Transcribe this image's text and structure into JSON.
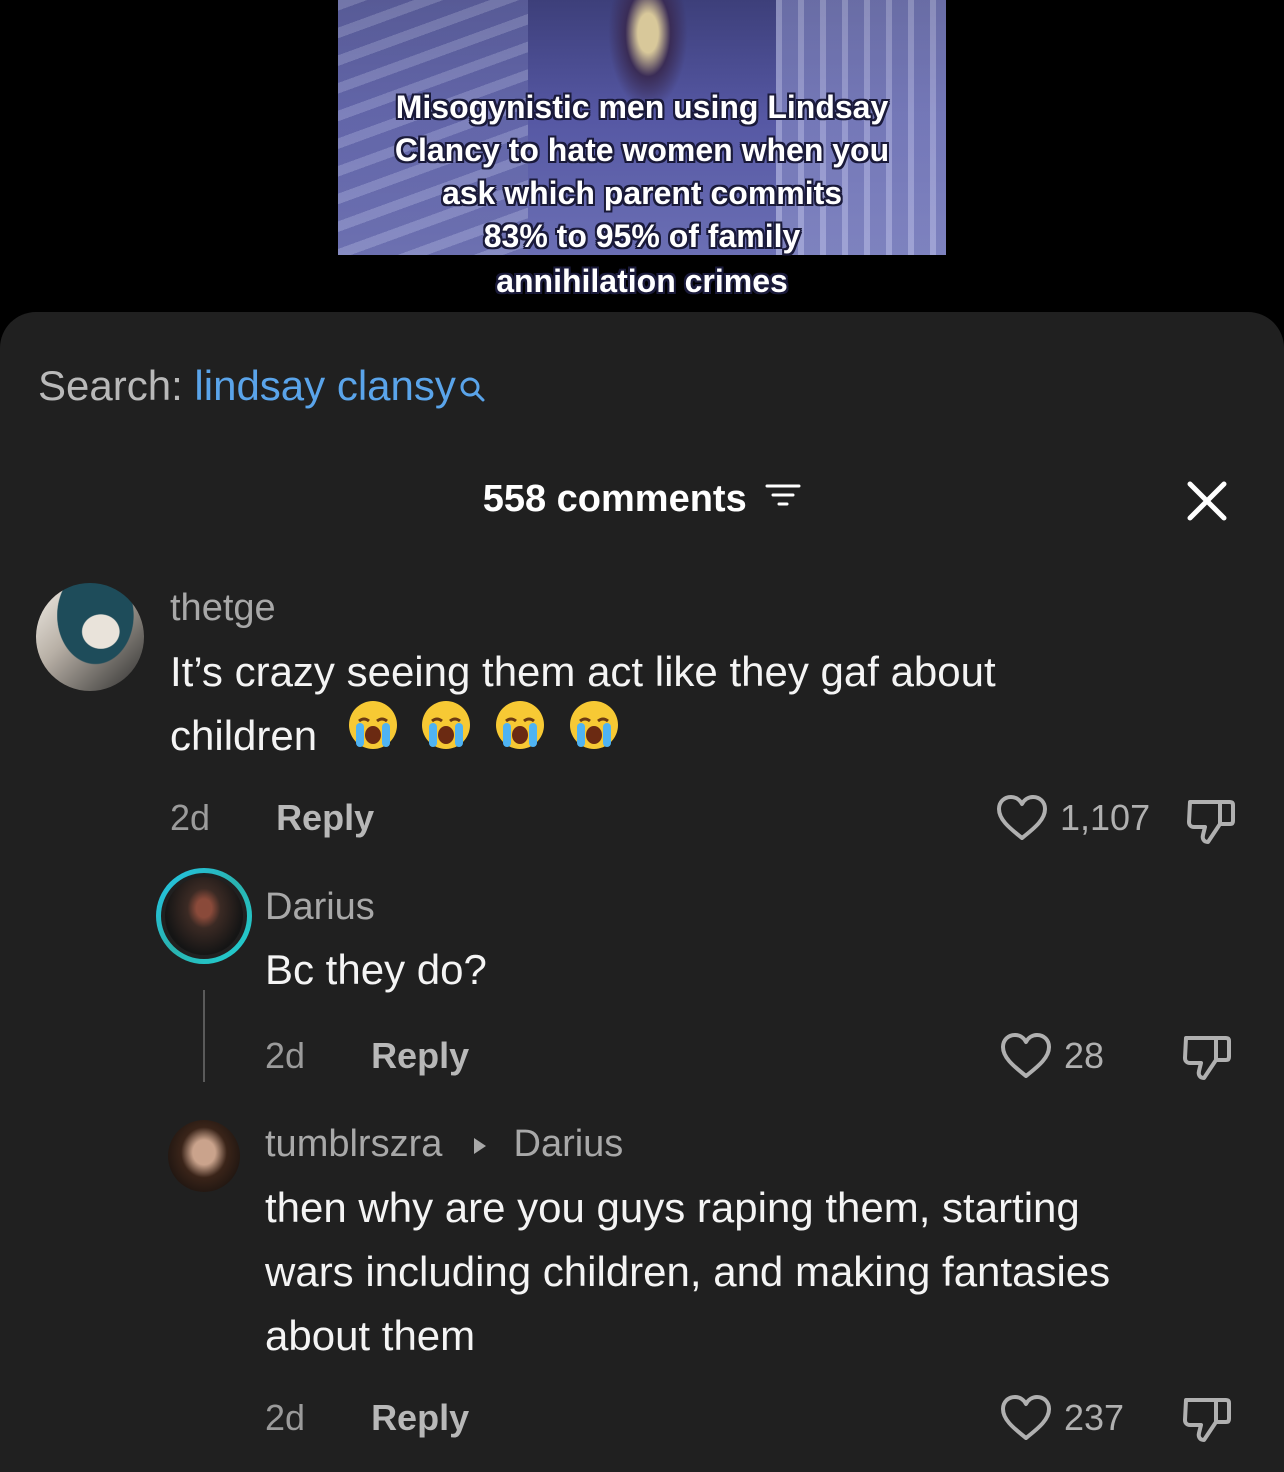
{
  "video": {
    "caption_lines": [
      "Misogynistic men using Lindsay",
      "Clancy to hate women when you",
      "ask which parent commits",
      "83% to 95% of family",
      "annihilation crimes"
    ]
  },
  "search": {
    "prefix": "Search:",
    "term": "lindsay clansy"
  },
  "header": {
    "comment_count_label": "558 comments"
  },
  "comments": [
    {
      "username": "thetge",
      "text_line1": "It’s crazy seeing them act like they gaf about",
      "text_line2": "children",
      "emoji_count": 4,
      "emoji": "loudly-crying-face",
      "time": "2d",
      "reply_label": "Reply",
      "likes": "1,107"
    },
    {
      "username": "Darius",
      "text": "Bc they do?",
      "time": "2d",
      "reply_label": "Reply",
      "likes": "28"
    },
    {
      "username": "tumblrszra",
      "reply_to": "Darius",
      "text_line1": "then why are you guys raping them, starting",
      "text_line2": "wars including children, and making fantasies",
      "text_line3": "about them",
      "time": "2d",
      "reply_label": "Reply",
      "likes": "237"
    }
  ],
  "colors": {
    "sheet_bg": "#202020",
    "search_term": "#5aa4ea",
    "story_ring": "#22c7e8"
  }
}
